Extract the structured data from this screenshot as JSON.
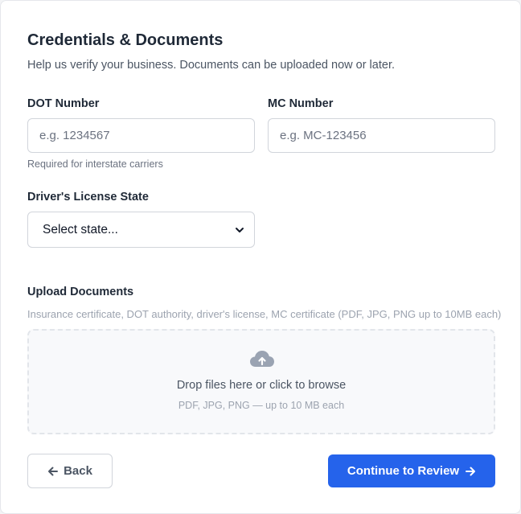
{
  "header": {
    "title": "Credentials & Documents",
    "subtitle": "Help us verify your business. Documents can be uploaded now or later."
  },
  "dot": {
    "label": "DOT Number",
    "placeholder": "e.g. 1234567",
    "value": "",
    "hint": "Required for interstate carriers"
  },
  "mc": {
    "label": "MC Number",
    "placeholder": "e.g. MC-123456",
    "value": ""
  },
  "license_state": {
    "label": "Driver's License State",
    "selected": "Select state..."
  },
  "upload": {
    "label": "Upload Documents",
    "description": "Insurance certificate, DOT authority, driver's license, MC certificate (PDF, JPG, PNG up to 10MB each)",
    "drop_text": "Drop files here or click to browse",
    "drop_subtext": "PDF, JPG, PNG — up to 10 MB each",
    "icon": "cloud-upload-icon"
  },
  "actions": {
    "back_label": "Back",
    "continue_label": "Continue to Review"
  },
  "colors": {
    "primary": "#2563eb",
    "text": "#1f2937",
    "muted": "#6b7280",
    "border": "#d1d5db"
  }
}
